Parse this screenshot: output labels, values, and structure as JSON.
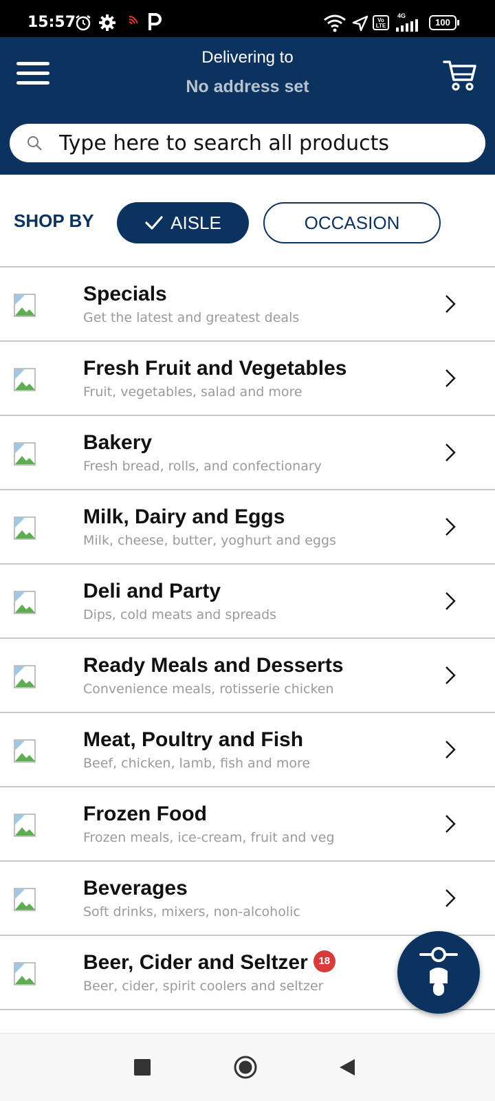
{
  "status_bar": {
    "time": "15:57",
    "battery": "100",
    "network": "4G",
    "carrier_badge": "Vo LTE",
    "icons": [
      "alarm-icon",
      "gear-icon",
      "nfc-icon",
      "parking-icon",
      "wifi-icon",
      "location-icon",
      "signal-icon",
      "battery-icon"
    ]
  },
  "header": {
    "delivering_label": "Delivering to",
    "address": "No address set",
    "colors": {
      "primary": "#0c3360",
      "address_text": "#b9c3ce"
    }
  },
  "search": {
    "placeholder": "Type here to search all products"
  },
  "shop_by": {
    "label": "SHOP BY",
    "tabs": [
      {
        "label": "AISLE",
        "selected": true
      },
      {
        "label": "OCCASION",
        "selected": false
      }
    ]
  },
  "categories": [
    {
      "title": "Specials",
      "subtitle": "Get the latest and greatest deals"
    },
    {
      "title": "Fresh Fruit and Vegetables",
      "subtitle": "Fruit, vegetables, salad and more"
    },
    {
      "title": "Bakery",
      "subtitle": "Fresh bread, rolls, and confectionary"
    },
    {
      "title": "Milk, Dairy and Eggs",
      "subtitle": "Milk, cheese, butter, yoghurt and eggs"
    },
    {
      "title": "Deli and Party",
      "subtitle": "Dips, cold meats and spreads"
    },
    {
      "title": "Ready Meals and Desserts",
      "subtitle": "Convenience meals, rotisserie chicken"
    },
    {
      "title": "Meat, Poultry and Fish",
      "subtitle": "Beef, chicken, lamb, fish and more"
    },
    {
      "title": "Frozen Food",
      "subtitle": "Frozen meals, ice-cream, fruit and veg"
    },
    {
      "title": "Beverages",
      "subtitle": "Soft drinks, mixers, non-alcoholic"
    },
    {
      "title": "Beer, Cider and Seltzer",
      "subtitle": "Beer, cider, spirit coolers and seltzer",
      "badge": "18"
    }
  ],
  "fab": {
    "icon": "scooter-delivery-icon"
  },
  "nav_bar": {
    "buttons": [
      "recents-square-icon",
      "home-circle-icon",
      "back-triangle-icon"
    ]
  }
}
